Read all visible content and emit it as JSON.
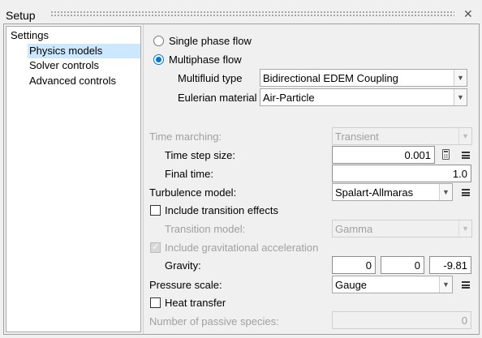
{
  "window": {
    "title": "Setup"
  },
  "tree": {
    "items": [
      {
        "label": "Settings"
      },
      {
        "label": "Physics models"
      },
      {
        "label": "Solver controls"
      },
      {
        "label": "Advanced controls"
      }
    ]
  },
  "physics": {
    "single_phase_label": "Single phase flow",
    "multiphase_label": "Multiphase flow",
    "selected": "Multiphase flow",
    "multifluid_type_label": "Multifluid type",
    "multifluid_type_value": "Bidirectional EDEM Coupling",
    "eulerian_material_label": "Eulerian material",
    "eulerian_material_value": "Air-Particle",
    "time_marching_label": "Time marching:",
    "time_marching_value": "Transient",
    "time_step_label": "Time step size:",
    "time_step_value": "0.001",
    "final_time_label": "Final time:",
    "final_time_value": "1.0",
    "turbulence_label": "Turbulence model:",
    "turbulence_value": "Spalart-Allmaras",
    "include_transition_label": "Include transition effects",
    "include_transition_checked": false,
    "transition_model_label": "Transition model:",
    "transition_model_value": "Gamma",
    "include_gravity_label": "Include gravitational acceleration",
    "include_gravity_checked": true,
    "gravity_label": "Gravity:",
    "gravity_x": "0",
    "gravity_y": "0",
    "gravity_z": "-9.81",
    "pressure_scale_label": "Pressure scale:",
    "pressure_scale_value": "Gauge",
    "heat_transfer_label": "Heat transfer",
    "heat_transfer_checked": false,
    "passive_species_label": "Number of passive species:",
    "passive_species_value": "0"
  },
  "icons": {
    "close": "close-icon",
    "calculator": "calculator-icon",
    "menu": "menu-icon",
    "dropdown": "chevron-down-icon"
  },
  "colors": {
    "accent": "#0078d7",
    "selection": "#cce8ff",
    "disabled_text": "#a0a0a0"
  }
}
